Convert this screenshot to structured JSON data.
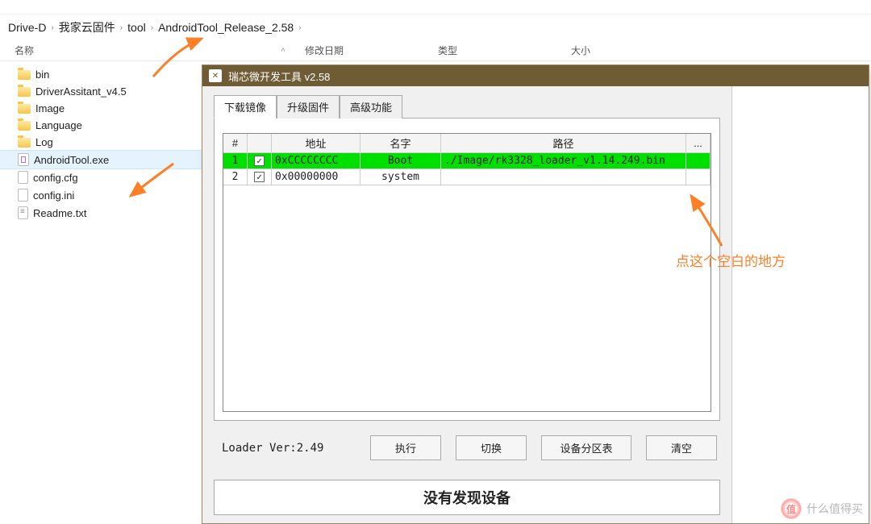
{
  "toolbar_hints": [
    "",
    "",
    "",
    ""
  ],
  "breadcrumb": [
    "Drive-D",
    "我家云固件",
    "tool",
    "AndroidTool_Release_2.58"
  ],
  "columns": {
    "name": "名称",
    "modified": "修改日期",
    "type": "类型",
    "size": "大小"
  },
  "files": [
    {
      "name": "bin",
      "kind": "folder"
    },
    {
      "name": "DriverAssitant_v4.5",
      "kind": "folder"
    },
    {
      "name": "Image",
      "kind": "folder"
    },
    {
      "name": "Language",
      "kind": "folder"
    },
    {
      "name": "Log",
      "kind": "folder"
    },
    {
      "name": "AndroidTool.exe",
      "kind": "exe",
      "selected": true
    },
    {
      "name": "config.cfg",
      "kind": "file"
    },
    {
      "name": "config.ini",
      "kind": "file"
    },
    {
      "name": "Readme.txt",
      "kind": "txt"
    }
  ],
  "tool": {
    "title": "瑞芯微开发工具 v2.58",
    "tabs": [
      "下载镜像",
      "升级固件",
      "高级功能"
    ],
    "grid_headers": {
      "num": "#",
      "chk": "",
      "addr": "地址",
      "name": "名字",
      "path": "路径",
      "ext": "..."
    },
    "rows": [
      {
        "num": "1",
        "checked": true,
        "addr": "0xCCCCCCCC",
        "name": "Boot",
        "path": "./Image/rk3328_loader_v1.14.249.bin",
        "highlight": true
      },
      {
        "num": "2",
        "checked": true,
        "addr": "0x00000000",
        "name": "system",
        "path": "",
        "highlight": false
      }
    ],
    "loader_ver": "Loader Ver:2.49",
    "buttons": {
      "run": "执行",
      "switch": "切换",
      "parttable": "设备分区表",
      "clear": "清空"
    },
    "status": "没有发现设备"
  },
  "annotation": "点这个空白的地方",
  "watermark": {
    "badge": "值",
    "text": "什么值得买"
  }
}
